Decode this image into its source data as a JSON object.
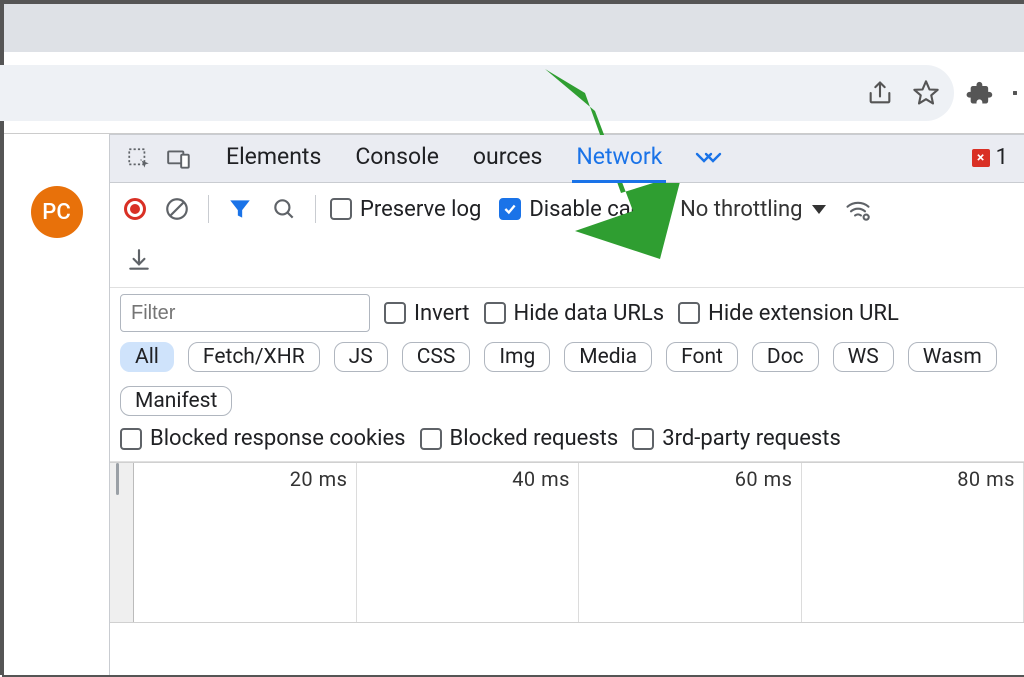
{
  "avatar": {
    "initials": "PC"
  },
  "devtools": {
    "tabs": {
      "elements": "Elements",
      "console": "Console",
      "sources": "ources",
      "network": "Network"
    },
    "errors_count": "1",
    "toolbar": {
      "preserve_log": "Preserve log",
      "disable_cache": "Disable cache",
      "throttling": "No throttling"
    },
    "filterbar": {
      "filter_placeholder": "Filter",
      "invert": "Invert",
      "hide_data_urls": "Hide data URLs",
      "hide_ext_urls": "Hide extension URL",
      "types": {
        "all": "All",
        "fetch": "Fetch/XHR",
        "js": "JS",
        "css": "CSS",
        "img": "Img",
        "media": "Media",
        "font": "Font",
        "doc": "Doc",
        "ws": "WS",
        "wasm": "Wasm",
        "manifest": "Manifest"
      },
      "blocked_cookies": "Blocked response cookies",
      "blocked_requests": "Blocked requests",
      "third_party": "3rd-party requests"
    },
    "timeline": {
      "t1": "20 ms",
      "t2": "40 ms",
      "t3": "60 ms",
      "t4": "80 ms"
    }
  }
}
